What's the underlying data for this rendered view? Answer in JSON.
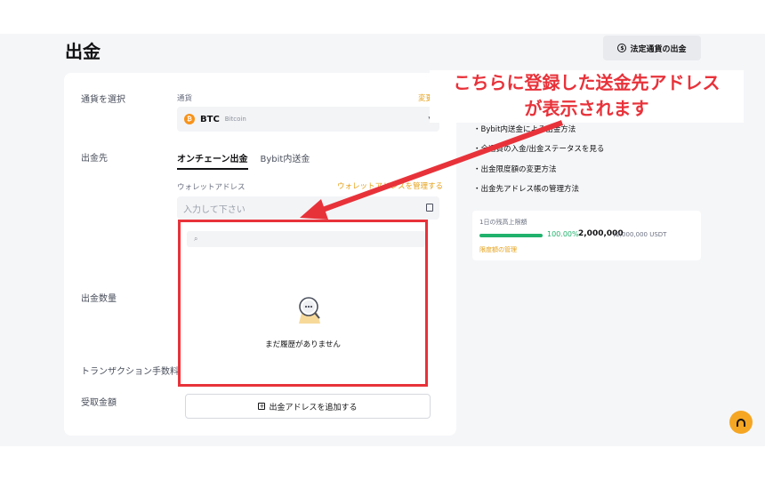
{
  "header": {
    "title": "出金",
    "fiat_button": "法定通貨の出金",
    "fiat_icon_text": "$"
  },
  "form": {
    "currency_label": "通貨を選択",
    "currency_small": "通貨",
    "change_link": "変更",
    "coin_icon_text": "₿",
    "coin_symbol": "BTC",
    "coin_name": "Bitcoin",
    "destination_label": "出金先",
    "tabs": [
      "オンチェーン出金",
      "Bybit内送金"
    ],
    "wallet_label": "ウォレットアドレス",
    "wallet_link": "ウォレットアドレスを管理する",
    "address_placeholder": "入力して下さい",
    "amount_label": "出金数量",
    "fee_label": "トランザクション手数料",
    "receive_label": "受取金額"
  },
  "dropdown": {
    "empty_text": "まだ履歴がありません",
    "add_button": "出金アドレスを追加する"
  },
  "faq": [
    "Bybit内送金による出金方法",
    "全通貨の入金/出金ステータスを見る",
    "出金限度額の変更方法",
    "出金先アドレス帳の管理方法"
  ],
  "limit": {
    "title": "1日の残高上限額",
    "progress": 1.0,
    "percent": "100.00%",
    "amount": "2,000,000",
    "total": "/2,000,000 USDT",
    "link": "限度額の管理"
  },
  "annotation": {
    "line1": "こちらに登録した送金先アドレス",
    "line2": "が表示されます"
  },
  "colors": {
    "accent": "#e5a11a",
    "annotation": "#e8323a",
    "success": "#20b26c"
  }
}
